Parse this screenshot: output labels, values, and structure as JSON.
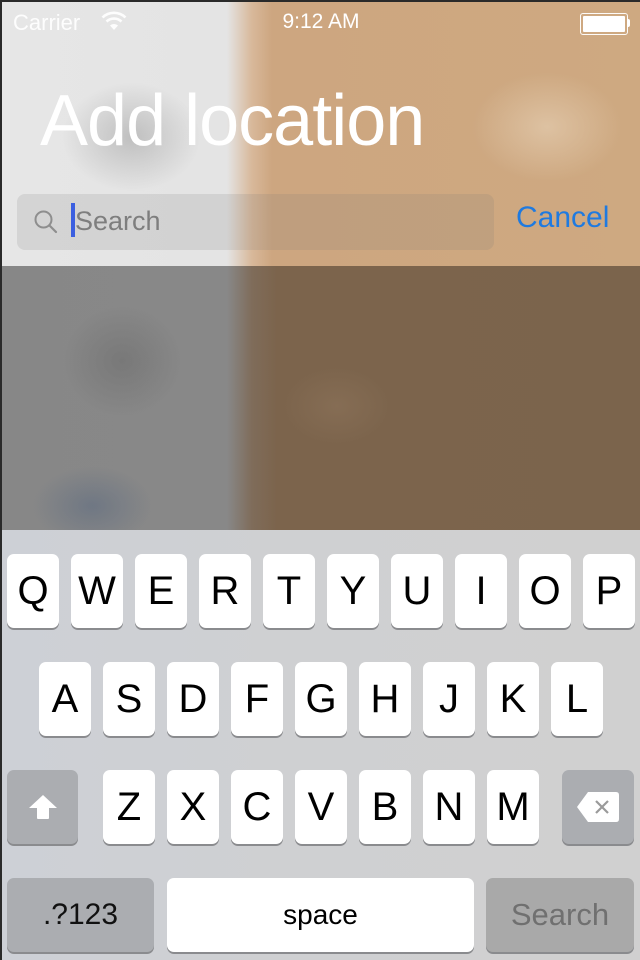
{
  "status_bar": {
    "carrier": "Carrier",
    "time": "9:12 AM",
    "battery_level": 1.0,
    "icons": [
      "wifi-icon",
      "battery-icon"
    ]
  },
  "header": {
    "title": "Add location"
  },
  "search": {
    "placeholder": "Search",
    "value": "",
    "icon": "search-icon",
    "cancel_label": "Cancel"
  },
  "colors": {
    "accent": "#1f7ae0",
    "cursor": "#3b5fe0"
  },
  "keyboard": {
    "row1": [
      "Q",
      "W",
      "E",
      "R",
      "T",
      "Y",
      "U",
      "I",
      "O",
      "P"
    ],
    "row2": [
      "A",
      "S",
      "D",
      "F",
      "G",
      "H",
      "J",
      "K",
      "L"
    ],
    "row3": [
      "Z",
      "X",
      "C",
      "V",
      "B",
      "N",
      "M"
    ],
    "shift_icon": "shift-arrow-icon",
    "delete_icon": "backspace-icon",
    "numbers_label": ".?123",
    "space_label": "space",
    "return_label": "Search"
  }
}
